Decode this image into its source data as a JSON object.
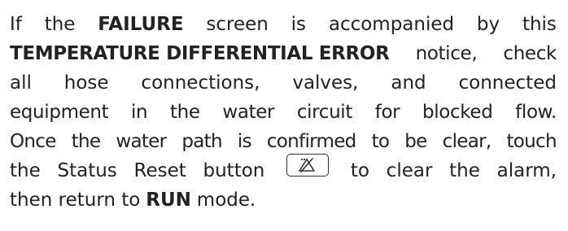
{
  "notice": {
    "line1": {
      "w1": "If",
      "w2": "the",
      "w3": "FAILURE",
      "w4": "screen",
      "w5": "is",
      "w6": "accompanied",
      "w7": "by",
      "w8": "this"
    },
    "line2": {
      "bold": "TEMPERATURE DIFFERENTIAL ERROR",
      "w1": "notice,",
      "w2": "check"
    },
    "line3": {
      "w1": "all",
      "w2": "hose",
      "w3": "connections,",
      "w4": "valves,",
      "w5": "and",
      "w6": "connected"
    },
    "line4": {
      "w1": "equipment",
      "w2": "in",
      "w3": "the",
      "w4": "water",
      "w5": "circuit",
      "w6": "for",
      "w7": "blocked",
      "w8": "flow."
    },
    "line5": {
      "w1": "Once",
      "w2": "the",
      "w3": "water",
      "w4": "path",
      "w5": "is",
      "w6": "confirmed",
      "w7": "to",
      "w8": "be",
      "w9": "clear,",
      "w10": "touch"
    },
    "line6": {
      "w1": "the",
      "w2": "Status",
      "w3": "Reset",
      "w4": "button",
      "w5": "to",
      "w6": "clear",
      "w7": "the",
      "w8": "alarm,"
    },
    "line7": {
      "pre": "then return to",
      "bold": "RUN",
      "post": "mode."
    }
  },
  "icons": {
    "status_reset": "status-reset-icon"
  },
  "colors": {
    "text": "#222222",
    "icon_stroke": "#333333"
  }
}
